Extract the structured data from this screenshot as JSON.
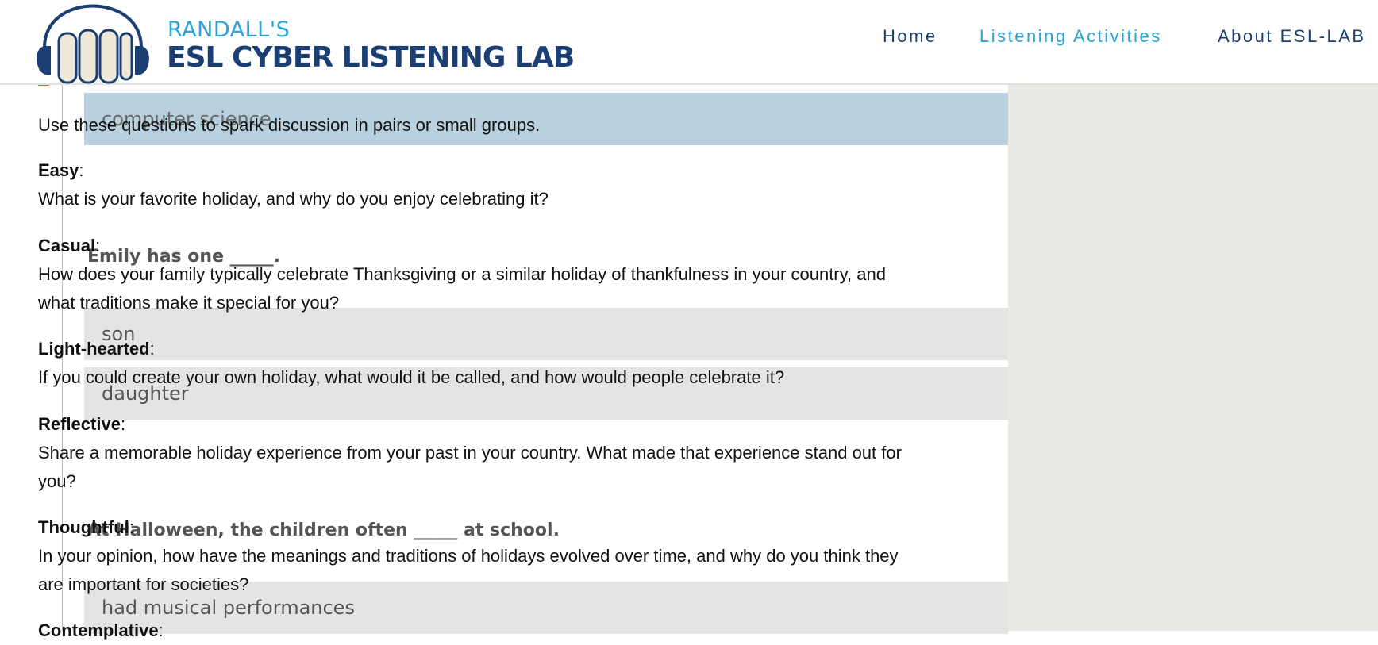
{
  "header": {
    "logo_top": "RANDALL'S",
    "logo_main": "ESL CYBER LISTENING LAB",
    "nav": [
      {
        "label": "Home"
      },
      {
        "label": "Listening Activities"
      },
      {
        "label": "About ESL-LAB"
      }
    ]
  },
  "quiz": {
    "option_selected": "computer science",
    "question1": "Emily has one _____.",
    "q1_options": [
      "son",
      "daughter"
    ],
    "question2": "At Halloween, the children often _____ at school.",
    "q2_options": [
      "had musical performances"
    ]
  },
  "article": {
    "intro": "Use these questions to spark discussion in pairs or small groups.",
    "sections": [
      {
        "label": "Easy",
        "lines": [
          "What is your favorite holiday, and why do you enjoy celebrating it?"
        ]
      },
      {
        "label": "Casual",
        "lines": [
          "How does your family typically celebrate Thanksgiving or a similar holiday of thankfulness in your country, and",
          "what traditions make it special for you?"
        ]
      },
      {
        "label": "Light-hearted",
        "lines": [
          "If you could create your own holiday, what would it be called, and how would people celebrate it?"
        ]
      },
      {
        "label": "Reflective",
        "lines": [
          "Share a memorable holiday experience from your past in your country. What made that experience stand out for",
          "you?"
        ]
      },
      {
        "label": "Thoughtful",
        "lines": [
          "In your opinion, how have the meanings and traditions of holidays evolved over time, and why do you think they",
          "are important for societies?"
        ]
      },
      {
        "label": "Contemplative",
        "lines": []
      }
    ]
  },
  "colors": {
    "brand_navy": "#1b3f73",
    "brand_blue": "#29a3d9",
    "selected_option": "#b9d0df",
    "plain_option": "#e4e4e4",
    "sidebar_bg": "#eae9e5"
  },
  "icons": {
    "logo": "headphones-books-icon"
  }
}
